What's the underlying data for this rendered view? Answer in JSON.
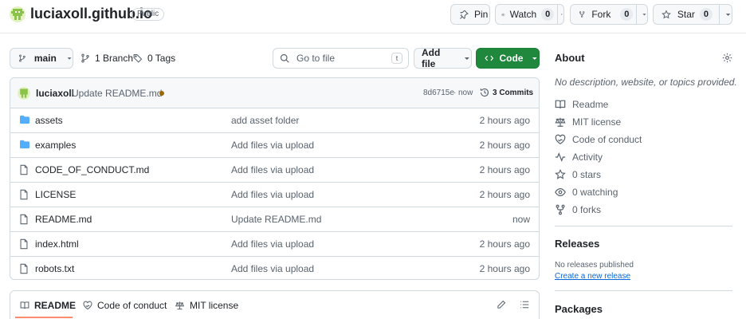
{
  "repo": {
    "name": "luciaxoll.github.io",
    "visibility": "Public"
  },
  "header_actions": {
    "pin": "Pin",
    "watch": {
      "label": "Watch",
      "count": "0"
    },
    "fork": {
      "label": "Fork",
      "count": "0"
    },
    "star": {
      "label": "Star",
      "count": "0"
    }
  },
  "toolbar": {
    "branch": "main",
    "branches": "1 Branch",
    "tags": "0 Tags",
    "search_placeholder": "Go to file",
    "search_key": "t",
    "add_file": "Add file",
    "code": "Code"
  },
  "commit": {
    "author": "luciaxoll",
    "message": "Update README.md",
    "hash": "8d6715e",
    "time": "now",
    "commits": "3 Commits",
    "status_color": "#9a6700"
  },
  "files": [
    {
      "name": "assets",
      "type": "folder",
      "message": "add asset folder",
      "time": "2 hours ago"
    },
    {
      "name": "examples",
      "type": "folder",
      "message": "Add files via upload",
      "time": "2 hours ago"
    },
    {
      "name": "CODE_OF_CONDUCT.md",
      "type": "file",
      "message": "Add files via upload",
      "time": "2 hours ago"
    },
    {
      "name": "LICENSE",
      "type": "file",
      "message": "Add files via upload",
      "time": "2 hours ago"
    },
    {
      "name": "README.md",
      "type": "file",
      "message": "Update README.md",
      "time": "now"
    },
    {
      "name": "index.html",
      "type": "file",
      "message": "Add files via upload",
      "time": "2 hours ago"
    },
    {
      "name": "robots.txt",
      "type": "file",
      "message": "Add files via upload",
      "time": "2 hours ago"
    }
  ],
  "readme_tabs": [
    "README",
    "Code of conduct",
    "MIT license"
  ],
  "about": {
    "title": "About",
    "description": "No description, website, or topics provided.",
    "items": [
      {
        "icon": "book-icon",
        "label": "Readme"
      },
      {
        "icon": "scale-icon",
        "label": "MIT license"
      },
      {
        "icon": "heart-icon",
        "label": "Code of conduct"
      },
      {
        "icon": "pulse-icon",
        "label": "Activity"
      },
      {
        "icon": "star-icon",
        "label": "0 stars"
      },
      {
        "icon": "eye-icon",
        "label": "0 watching"
      },
      {
        "icon": "fork-icon",
        "label": "0 forks"
      }
    ]
  },
  "releases": {
    "title": "Releases",
    "none": "No releases published",
    "create": "Create a new release"
  },
  "packages": {
    "title": "Packages"
  },
  "colors": {
    "accent_green": "#1f883d",
    "link": "#0969da",
    "folder": "#54aeff",
    "readme_underline": "#fd8c73"
  }
}
